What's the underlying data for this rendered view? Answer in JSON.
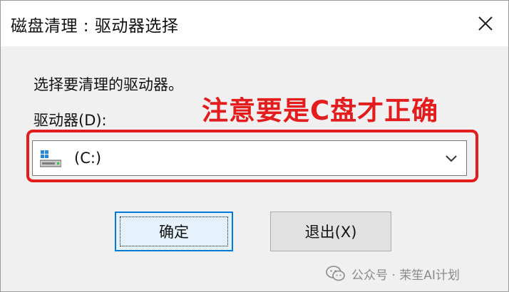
{
  "window": {
    "title": "磁盘清理 : 驱动器选择"
  },
  "content": {
    "prompt": "选择要清理的驱动器。",
    "drive_label": "驱动器(D):",
    "selected_drive": "(C:)"
  },
  "annotation": {
    "text": "注意要是C盘才正确",
    "color": "#e31d1d"
  },
  "buttons": {
    "ok_label": "确定",
    "exit_label": "退出(X)"
  },
  "watermark": {
    "text": "公众号 · 茉笙AI计划"
  },
  "icons": {
    "close": "close-icon",
    "drive": "drive-icon",
    "dropdown": "chevron-down-icon",
    "wechat": "wechat-icon"
  },
  "colors": {
    "accent": "#0078d7",
    "highlight": "#e31d1d"
  }
}
